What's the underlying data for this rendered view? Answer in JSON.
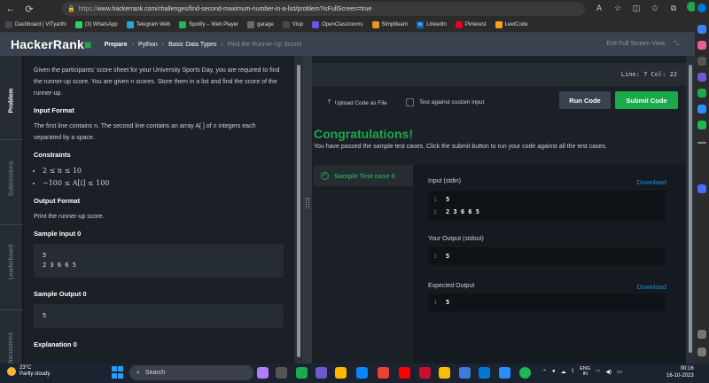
{
  "browser": {
    "url_scheme": "https://",
    "url_rest": "www.hackerrank.com/challenges/find-second-maximum-number-in-a-list/problem?isFullScreen=true",
    "bookmarks": [
      {
        "label": "Dashboard | VITyarthi",
        "color": "#444a55",
        "glyph": ""
      },
      {
        "label": "(3) WhatsApp",
        "color": "#25d366",
        "glyph": ""
      },
      {
        "label": "Telegram Web",
        "color": "#2aa3df",
        "glyph": ""
      },
      {
        "label": "Spotify – Web Player",
        "color": "#1db954",
        "glyph": ""
      },
      {
        "label": "garage",
        "color": "#6b6b6b",
        "glyph": ""
      },
      {
        "label": "Vtop",
        "color": "#444a55",
        "glyph": ""
      },
      {
        "label": "OpenClassrooms",
        "color": "#7451eb",
        "glyph": ""
      },
      {
        "label": "Simplilearn",
        "color": "#e9952a",
        "glyph": ""
      },
      {
        "label": "LinkedIn",
        "color": "#0a66c2",
        "glyph": "in"
      },
      {
        "label": "Pinterest",
        "color": "#e60023",
        "glyph": ""
      },
      {
        "label": "LeetCode",
        "color": "#ffa116",
        "glyph": ""
      }
    ]
  },
  "header": {
    "logo_main": "HackerRank",
    "crumbs": [
      "Prepare",
      "Python",
      "Basic Data Types",
      "Find the Runner-Up Score!"
    ],
    "exit_fullscreen": "Exit Full Screen View"
  },
  "vtabs": {
    "problem": "Problem",
    "submissions": "Submissions",
    "leaderboard": "Leaderboard",
    "discussions": "Discussions"
  },
  "problem": {
    "intro": "Given the participants' score sheet for your University Sports Day, you are required to find the runner-up score. You are given n scores. Store them in a list and find the score of the runner-up.",
    "input_format_title": "Input Format",
    "input_format_text": "The first line contains n. The second line contains an array A[ ] of n integers each separated by a space.",
    "constraints_title": "Constraints",
    "constraint_1": "2 ≤ n ≤ 10",
    "constraint_2": "−100 ≤ A[i] ≤ 100",
    "output_format_title": "Output Format",
    "output_format_text": "Print the runner-up score.",
    "sample_input_title": "Sample Input 0",
    "sample_input": "5\n2 3 6 6 5",
    "sample_output_title": "Sample Output 0",
    "sample_output": "5",
    "explanation_title": "Explanation 0"
  },
  "editor": {
    "line_col": "Line: 7  Col: 22",
    "upload_label": "Upload Code as File",
    "custom_input_label": "Test against custom input",
    "run_label": "Run Code",
    "submit_label": "Submit Code"
  },
  "result": {
    "title": "Congratulations!",
    "message": "You have passed the sample test cases. Click the submit button to run your code against all the test cases.",
    "case_label": "Sample Test case 0",
    "input_label": "Input (stdin)",
    "download_label": "Download",
    "input_lines": [
      {
        "n": "1",
        "v": "5"
      },
      {
        "n": "2",
        "v": "2 3 6 6 5"
      }
    ],
    "your_output_label": "Your Output (stdout)",
    "your_output_lines": [
      {
        "n": "1",
        "v": "5"
      }
    ],
    "expected_label": "Expected Output",
    "expected_download": "Download",
    "expected_lines": [
      {
        "n": "1",
        "v": "5"
      }
    ]
  },
  "taskbar": {
    "temp": "23°C",
    "weather": "Partly cloudy",
    "search_placeholder": "Search",
    "lang_1": "ENG",
    "lang_2": "IN",
    "time": "00:16",
    "date": "16-10-2023"
  },
  "colors": {
    "accent_green": "#1ba94c",
    "link_blue": "#1c8ddb",
    "header_bg": "#39424e"
  }
}
